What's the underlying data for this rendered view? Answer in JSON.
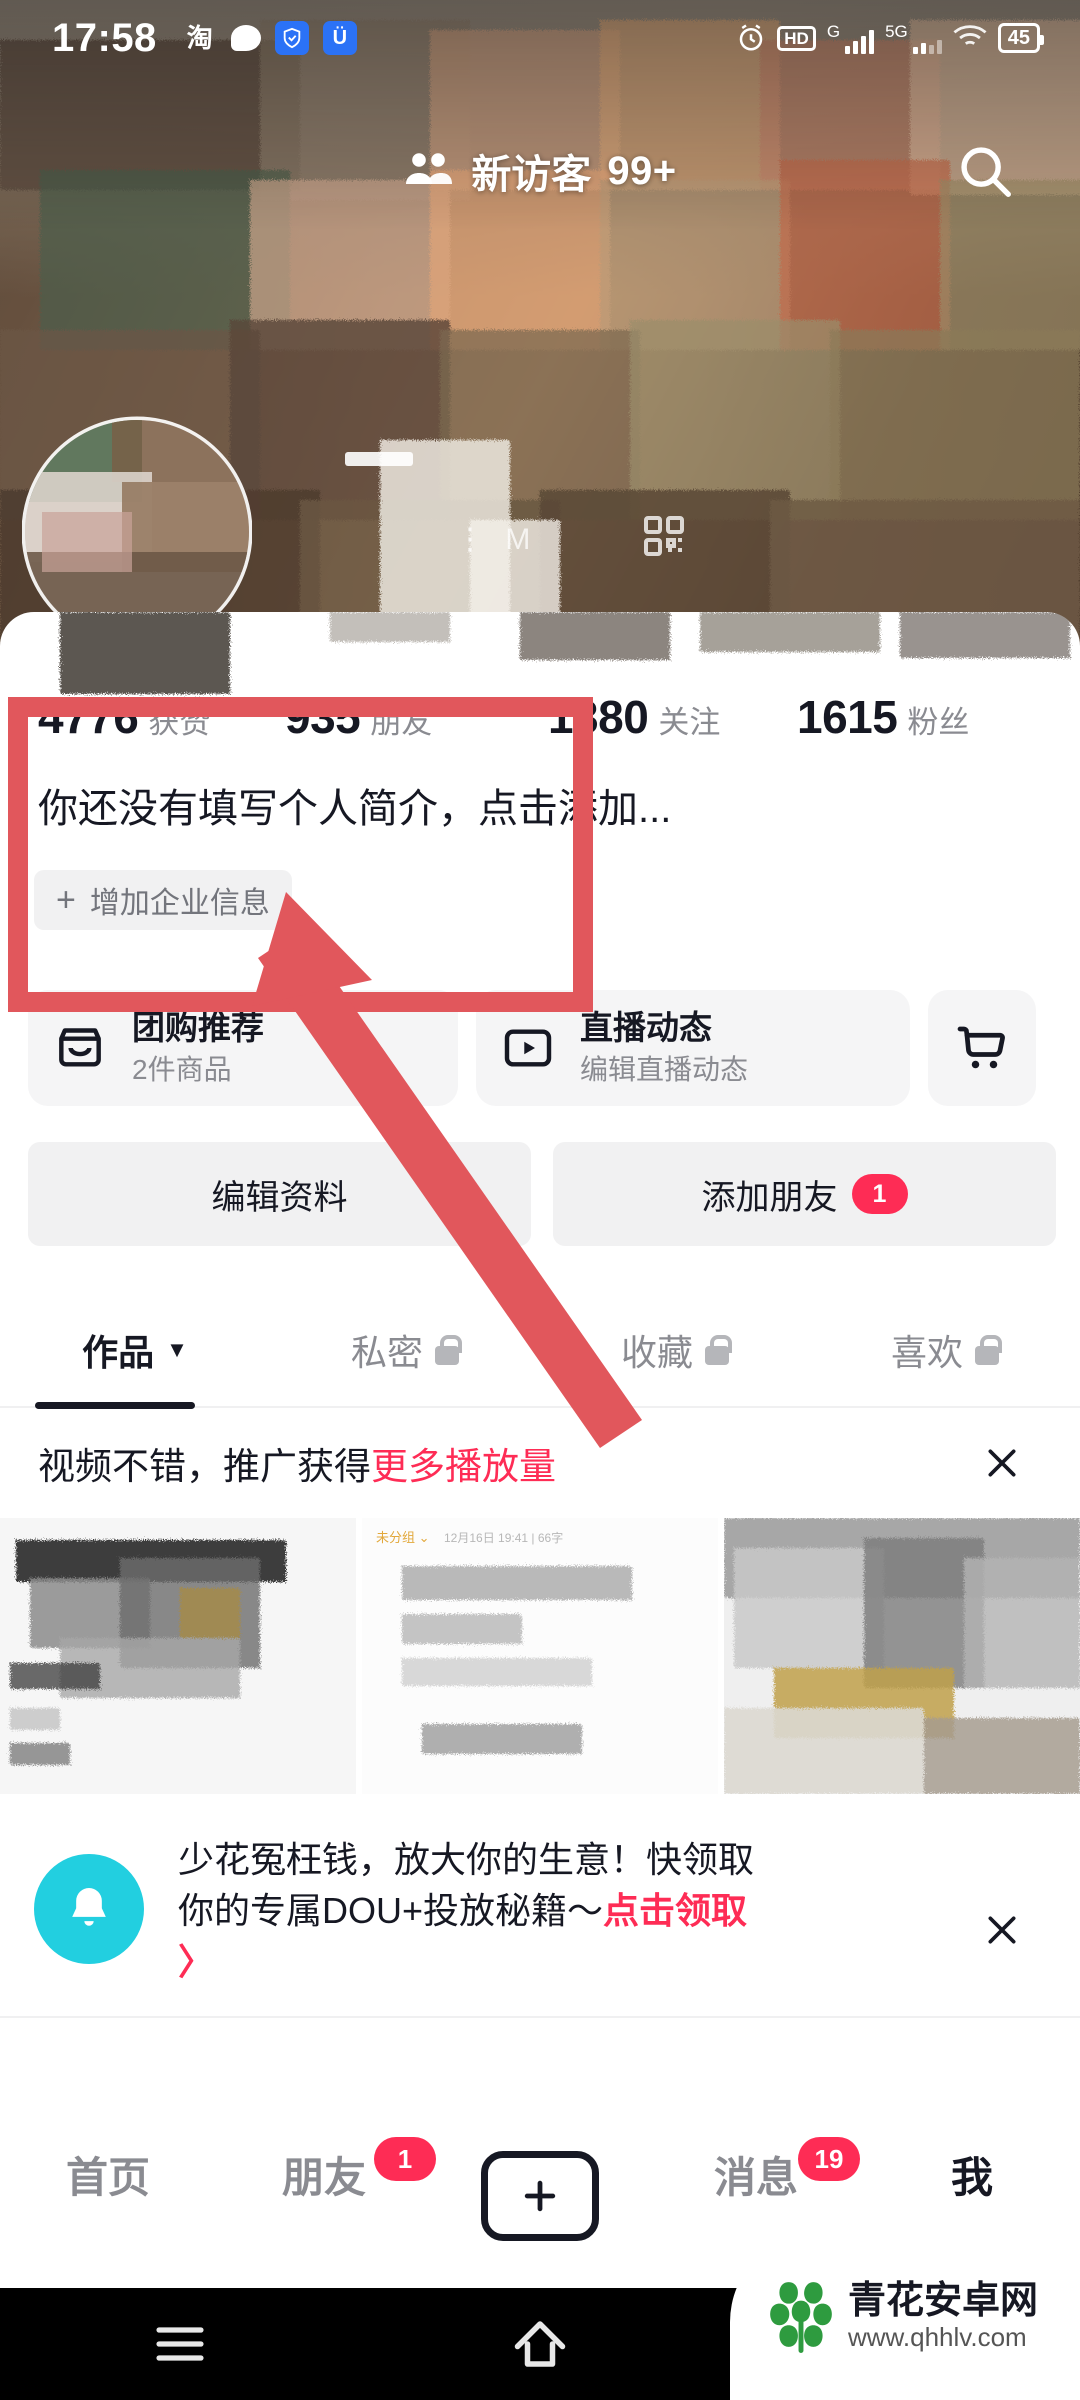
{
  "status_bar": {
    "time": "17:58",
    "left_icons": [
      "taobao-icon",
      "message-bubble-icon",
      "security-shield-icon",
      "bug-app-icon"
    ],
    "alarm_icon": "alarm-icon",
    "hd_label": "HD",
    "sim1_label": "G",
    "sim2_label": "5G",
    "wifi_icon": "wifi-icon",
    "battery_level": "45"
  },
  "header": {
    "visitor_icon": "people-icon",
    "visitor_label": "新访客",
    "visitor_count": "99+",
    "search_icon": "search-icon",
    "more_icon": "more-icon",
    "qr_icon": "qr-code-icon"
  },
  "profile": {
    "stats": [
      {
        "num": "4776",
        "label": "获赞"
      },
      {
        "num": "935",
        "label": "朋友"
      },
      {
        "num": "1380",
        "label": "关注"
      },
      {
        "num": "1615",
        "label": "粉丝"
      }
    ],
    "bio": "你还没有填写个人简介，点击添加...",
    "enterprise_button": {
      "plus": "+",
      "label": "增加企业信息"
    }
  },
  "shortcut_row": {
    "group_buy": {
      "icon": "store-icon",
      "title": "团购推荐",
      "subtitle": "2件商品"
    },
    "live": {
      "icon": "live-video-icon",
      "title": "直播动态",
      "subtitle": "编辑直播动态"
    },
    "cart": {
      "icon": "shopping-cart-icon"
    }
  },
  "actions": {
    "edit_profile": "编辑资料",
    "add_friend": "添加朋友",
    "add_friend_badge": "1"
  },
  "tabs": [
    {
      "label": "作品",
      "active": true,
      "caret": "▼",
      "locked": false
    },
    {
      "label": "私密",
      "active": false,
      "locked": true
    },
    {
      "label": "收藏",
      "active": false,
      "locked": true
    },
    {
      "label": "喜欢",
      "active": false,
      "locked": true
    }
  ],
  "promo": {
    "text_plain": "视频不错，推广获得",
    "text_highlight": "更多播放量",
    "close_icon": "close-icon"
  },
  "feed": {
    "thumbs": [
      {
        "overlay_text": "高新区有没有适合的职位"
      },
      {
        "category": "未分组",
        "meta": "12月16日 19:41 | 66字"
      },
      {
        "overlay_text": ""
      }
    ]
  },
  "dou_banner": {
    "icon": "bell-icon",
    "line1": "少花冤枉钱，放大你的生意！快领取",
    "line2_plain": "你的专属DOU+投放秘籍～",
    "line2_highlight": "点击领取",
    "arrow": "〉",
    "close_icon": "close-icon"
  },
  "bottom_nav": [
    {
      "label": "首页",
      "active": false,
      "badge": ""
    },
    {
      "label": "朋友",
      "active": false,
      "badge": "1"
    },
    {
      "label": "",
      "active": false,
      "badge": "",
      "icon": "plus-create-icon"
    },
    {
      "label": "消息",
      "active": false,
      "badge": "19"
    },
    {
      "label": "我",
      "active": true,
      "badge": ""
    }
  ],
  "system_nav": {
    "recents_icon": "recents-menu-icon",
    "home_icon": "home-icon",
    "back_icon": "back-icon"
  },
  "watermark": {
    "site_name": "青花安卓网",
    "site_url": "www.qhhlv.com",
    "logo_icon": "leaf-logo-icon"
  },
  "annotation": {
    "rect_color": "#e1575c",
    "arrow_color": "#e1575c",
    "shape": "rectangle-and-arrow"
  },
  "colors": {
    "accent_red": "#fe2c55",
    "text_primary": "#161823",
    "text_secondary": "#8a8b91",
    "chip_bg": "#f5f5f6",
    "bell_cyan": "#22cfe0"
  }
}
